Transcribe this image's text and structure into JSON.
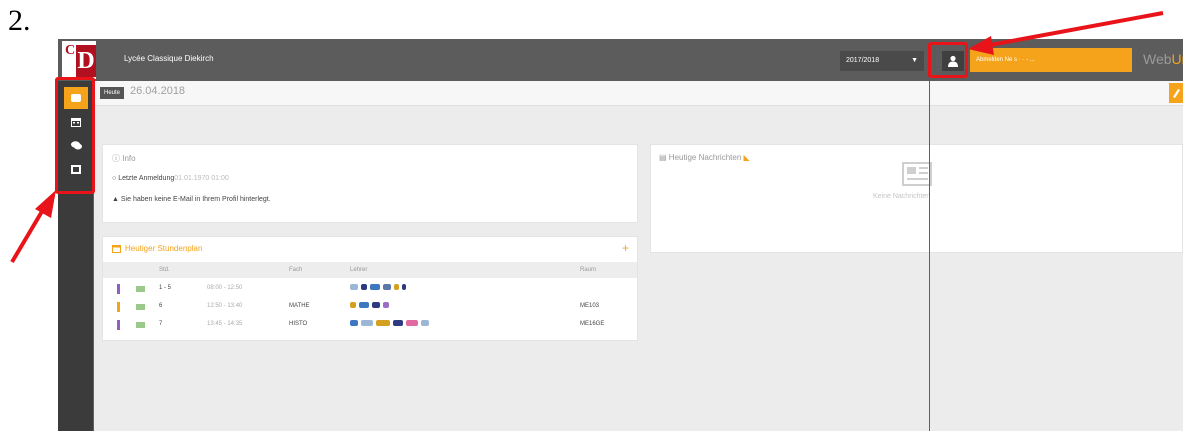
{
  "step_number": "2.",
  "topbar": {
    "school_name": "Lycée Classique Diekirch",
    "logo_letter_c": "C",
    "logo_letter_d": "D",
    "school_year": "2017/2018",
    "logout_label": "Abmelden Ne s  ·  · - ...",
    "brand_web": "Web",
    "brand_untis": "Unte"
  },
  "breadcrumb": {
    "today_tag": "Heute",
    "date": "26.04.2018"
  },
  "info": {
    "title": "Info",
    "last_login_label": "Letzte Anmeldung",
    "last_login_value": "01.01.1970 01:00",
    "no_email": "Sie haben keine E-Mail in Ihrem Profil hinterlegt."
  },
  "news": {
    "title": "Heutige Nachrichten",
    "empty": "Keine Nachrichten"
  },
  "schedule": {
    "title": "Heutiger Stundenplan",
    "plus": "+",
    "columns": [
      "Std.",
      "Fach",
      "Lehrer",
      "Raum"
    ],
    "rows": [
      {
        "lessons": "1 - 5",
        "time": "08:00 - 12:50",
        "subject": "",
        "room": "",
        "bar_color": "#8f5fc1"
      },
      {
        "lessons": "6",
        "time": "12:50 - 13:40",
        "subject": "MATHE",
        "room": "ME103",
        "bar_color": "#f5a31a"
      },
      {
        "lessons": "7",
        "time": "13:45 - 14:35",
        "subject": "HISTO",
        "room": "ME16GE",
        "bar_color": "#8f5fc1"
      }
    ]
  },
  "colors": {
    "accent": "#f5a31a",
    "topbar": "#5c5c5c",
    "sidebar": "#3b3b3b",
    "annotation_red": "#e8141a",
    "annotation_blue": "#2e66c8"
  },
  "icons": {
    "sidebar": [
      "home-icon",
      "calendar-icon",
      "messages-icon",
      "book-icon"
    ]
  }
}
